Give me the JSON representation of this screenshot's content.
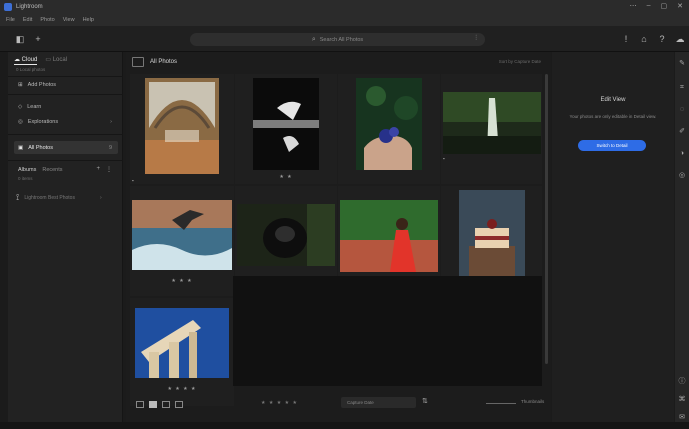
{
  "window": {
    "title": "Lightroom"
  },
  "menu": [
    "File",
    "Edit",
    "Photo",
    "View",
    "Help"
  ],
  "toolbar": {
    "search_placeholder": "Search All Photos"
  },
  "left": {
    "tabs": [
      {
        "label": "Cloud"
      },
      {
        "label": "Local"
      }
    ],
    "sub": "0 Local photos",
    "add_photos": "Add Photos",
    "nav": [
      {
        "label": "Learn"
      },
      {
        "label": "Explorations"
      }
    ],
    "all_photos": "All Photos",
    "all_count": "9",
    "albums": {
      "label": "Albums",
      "filter": "Recents",
      "sub": "0 items"
    },
    "tour_label": "Lightroom Best Photos"
  },
  "main": {
    "title": "All Photos",
    "sort_label": "Sort by Capture Date",
    "photos": [
      {
        "name": "station",
        "stars": ""
      },
      {
        "name": "hands",
        "stars": "★ ★"
      },
      {
        "name": "blueberries",
        "stars": ""
      },
      {
        "name": "waterfall",
        "stars": ""
      },
      {
        "name": "seagull",
        "stars": "★ ★ ★"
      },
      {
        "name": "gorilla",
        "stars": "★ ★ ★ ★"
      },
      {
        "name": "woman",
        "stars": "★ ★ ★ ★"
      },
      {
        "name": "cake",
        "stars": ""
      },
      {
        "name": "columns",
        "stars": "★ ★ ★ ★"
      }
    ],
    "rating_filter": "★ ★ ★ ★ ★",
    "sort_box": "Capture Date",
    "zoom_label": "Thumbnails"
  },
  "right": {
    "edit_title": "Edit View",
    "edit_desc": "Your photos are only editable in Detail view.",
    "edit_button": "Switch to Detail"
  },
  "colors": {
    "accent": "#2e6ce6",
    "background": "#1b1b1b"
  }
}
